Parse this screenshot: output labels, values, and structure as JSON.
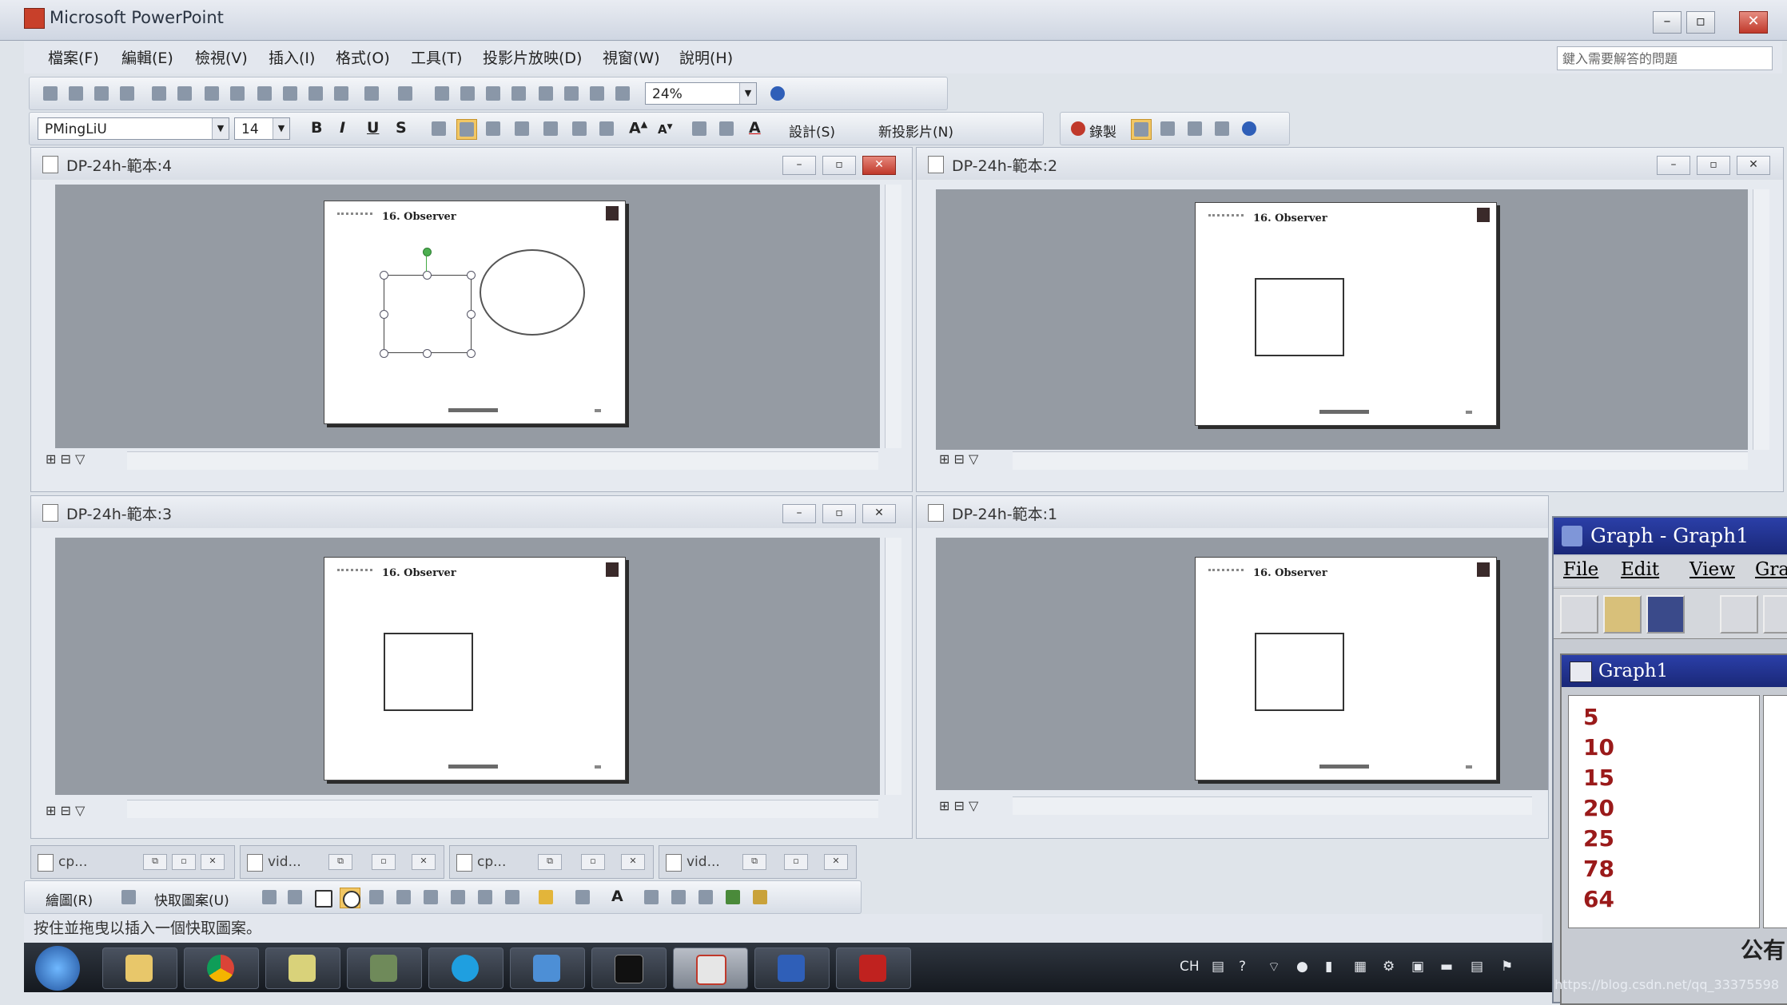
{
  "app": {
    "title": "Microsoft PowerPoint"
  },
  "menu": [
    "檔案(F)",
    "編輯(E)",
    "檢視(V)",
    "插入(I)",
    "格式(O)",
    "工具(T)",
    "投影片放映(D)",
    "視窗(W)",
    "說明(H)"
  ],
  "help_placeholder": "鍵入需要解答的問題",
  "toolbar": {
    "zoom": "24%",
    "font_name": "PMingLiU",
    "font_size": "14",
    "design_label": "設計(S)",
    "new_slide_label": "新投影片(N)",
    "record_label": "錄製"
  },
  "windows": [
    {
      "title": "DP-24h-範本:4",
      "slide_title": "16. Observer"
    },
    {
      "title": "DP-24h-範本:2",
      "slide_title": "16. Observer"
    },
    {
      "title": "DP-24h-範本:3",
      "slide_title": "16. Observer"
    },
    {
      "title": "DP-24h-範本:1",
      "slide_title": "16. Observer"
    }
  ],
  "mini_windows": [
    "cp...",
    "vid...",
    "cp...",
    "vid..."
  ],
  "drawbar": {
    "draw_label": "繪圖(R)",
    "autoshapes_label": "快取圖案(U)"
  },
  "status_text": "按住並拖曳以插入一個快取圖案。",
  "tray": {
    "lang": "CH"
  },
  "graph": {
    "window_title": "Graph - Graph1",
    "menu": [
      "File",
      "Edit",
      "View",
      "Grap"
    ],
    "child_title": "Graph1",
    "values": [
      "5",
      "10",
      "15",
      "20",
      "25",
      "78",
      "64"
    ],
    "corner_text": "公有"
  },
  "watermark": "https://blog.csdn.net/qq_33375598"
}
